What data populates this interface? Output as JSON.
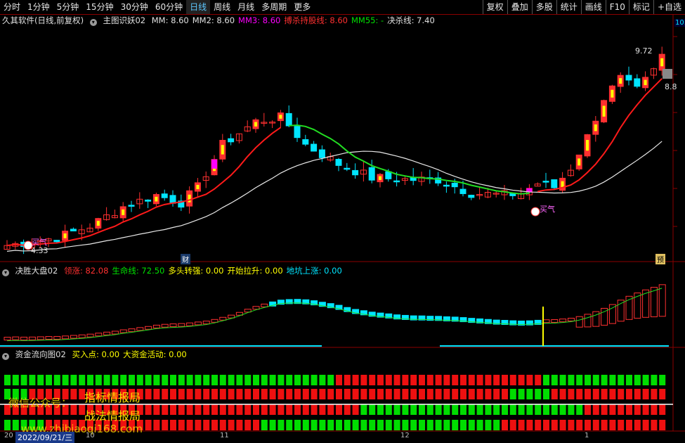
{
  "toolbar": {
    "left": [
      "分时",
      "1分钟",
      "5分钟",
      "15分钟",
      "30分钟",
      "60分钟",
      "日线",
      "周线",
      "月线",
      "多周期",
      "更多"
    ],
    "active": "日线",
    "right": [
      "复权",
      "叠加",
      "多股",
      "统计",
      "画线",
      "F10",
      "标记",
      "+自选"
    ]
  },
  "main_header": {
    "title": "久其软件(日线,前复权)",
    "indicator": "主图识妖02",
    "items": [
      {
        "label": "MM: 8.60",
        "color": "#e0e0e0"
      },
      {
        "label": "MM2: 8.60",
        "color": "#e0e0e0"
      },
      {
        "label": "MM3: 8.60",
        "color": "#ff00ff"
      },
      {
        "label": "搏杀持股线: 8.60",
        "color": "#ff3030"
      },
      {
        "label": "MM55: -",
        "color": "#00e000"
      },
      {
        "label": "决杀线: 7.40",
        "color": "#e0e0e0"
      }
    ]
  },
  "main_chart": {
    "price_high_label": "9.72",
    "price_low_label": "4.33",
    "right_price": "8.8",
    "right_top": "10.",
    "markers": [
      "财",
      "预"
    ],
    "signal_label": "买气",
    "colors": {
      "up": "#ff3030",
      "down": "#00e5ff",
      "red_line": "#ff1a1a",
      "white_line": "#e8e8e8",
      "green_line": "#22dd22",
      "yellow": "#ffff00",
      "magenta": "#ff00ff"
    }
  },
  "sub1_header": {
    "indicator": "决胜大盘02",
    "items": [
      {
        "label": "领涨: 82.08",
        "color": "#ff3030"
      },
      {
        "label": "生命线: 72.50",
        "color": "#00e000"
      },
      {
        "label": "多头转强: 0.00",
        "color": "#ffff00"
      },
      {
        "label": "开始拉升: 0.00",
        "color": "#ffff00"
      },
      {
        "label": "地坑上涨: 0.00",
        "color": "#00e5ff"
      }
    ]
  },
  "sub2_header": {
    "indicator": "资金流向图02",
    "items": [
      {
        "label": "买入点: 0.00",
        "color": "#ffff00"
      },
      {
        "label": "大资金活动: 0.00",
        "color": "#ffff00"
      }
    ]
  },
  "watermarks": [
    "微信公众号：",
    "指标情报局",
    "战法情报局",
    "www.zhibiaoqi168.com"
  ],
  "time_axis": {
    "date_box": "2022/09/21/三",
    "ticks": [
      "20",
      "10",
      "11",
      "12",
      "1"
    ]
  }
}
